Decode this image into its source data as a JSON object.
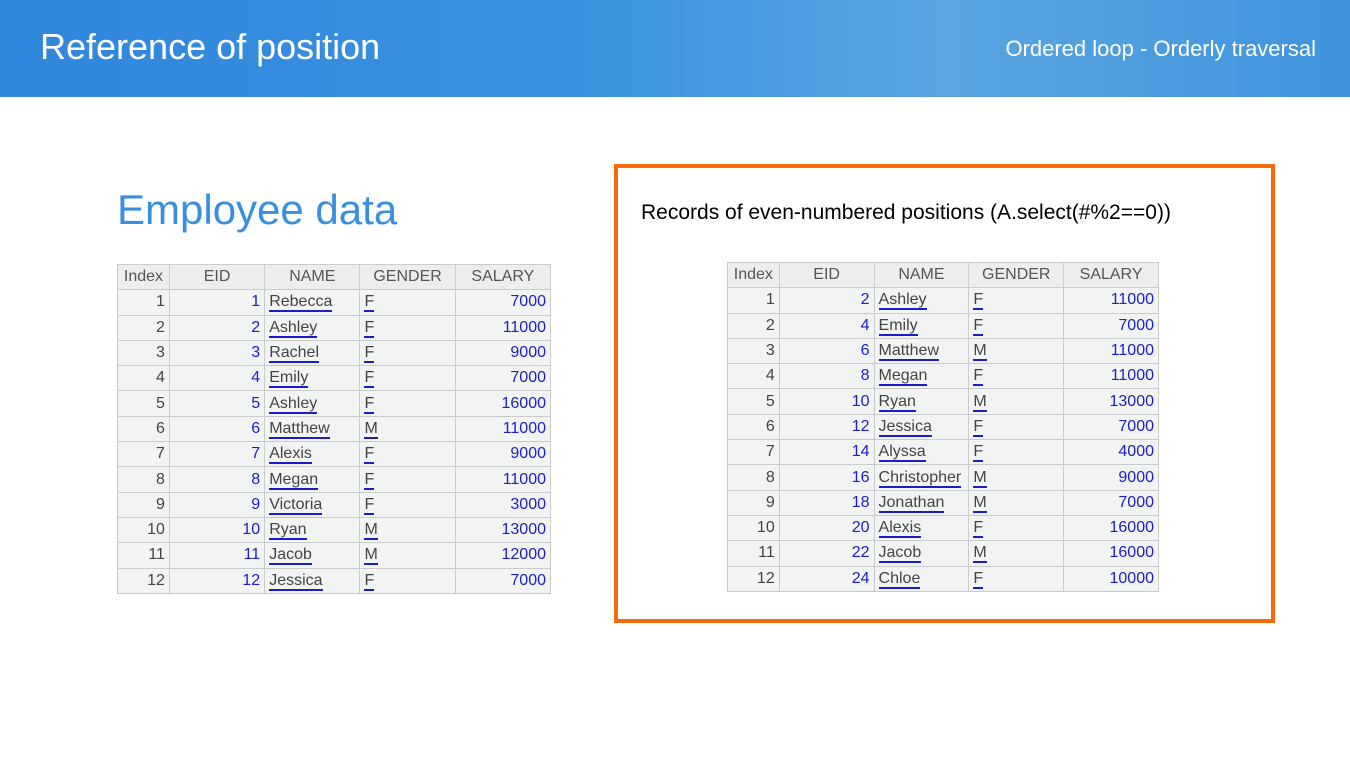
{
  "header": {
    "title": "Reference of position",
    "subtitle": "Ordered loop - Orderly traversal"
  },
  "left": {
    "heading": "Employee data",
    "columns": [
      "Index",
      "EID",
      "NAME",
      "GENDER",
      "SALARY"
    ],
    "rows": [
      [
        1,
        1,
        "Rebecca",
        "F",
        7000
      ],
      [
        2,
        2,
        "Ashley",
        "F",
        11000
      ],
      [
        3,
        3,
        "Rachel",
        "F",
        9000
      ],
      [
        4,
        4,
        "Emily",
        "F",
        7000
      ],
      [
        5,
        5,
        "Ashley",
        "F",
        16000
      ],
      [
        6,
        6,
        "Matthew",
        "M",
        11000
      ],
      [
        7,
        7,
        "Alexis",
        "F",
        9000
      ],
      [
        8,
        8,
        "Megan",
        "F",
        11000
      ],
      [
        9,
        9,
        "Victoria",
        "F",
        3000
      ],
      [
        10,
        10,
        "Ryan",
        "M",
        13000
      ],
      [
        11,
        11,
        "Jacob",
        "M",
        12000
      ],
      [
        12,
        12,
        "Jessica",
        "F",
        7000
      ]
    ]
  },
  "right": {
    "caption": "Records of even-numbered positions (A.select(#%2==0))",
    "columns": [
      "Index",
      "EID",
      "NAME",
      "GENDER",
      "SALARY"
    ],
    "rows": [
      [
        1,
        2,
        "Ashley",
        "F",
        11000
      ],
      [
        2,
        4,
        "Emily",
        "F",
        7000
      ],
      [
        3,
        6,
        "Matthew",
        "M",
        11000
      ],
      [
        4,
        8,
        "Megan",
        "F",
        11000
      ],
      [
        5,
        10,
        "Ryan",
        "M",
        13000
      ],
      [
        6,
        12,
        "Jessica",
        "F",
        7000
      ],
      [
        7,
        14,
        "Alyssa",
        "F",
        4000
      ],
      [
        8,
        16,
        "Christopher",
        "M",
        9000
      ],
      [
        9,
        18,
        "Jonathan",
        "M",
        7000
      ],
      [
        10,
        20,
        "Alexis",
        "F",
        16000
      ],
      [
        11,
        22,
        "Jacob",
        "M",
        16000
      ],
      [
        12,
        24,
        "Chloe",
        "F",
        10000
      ]
    ]
  }
}
